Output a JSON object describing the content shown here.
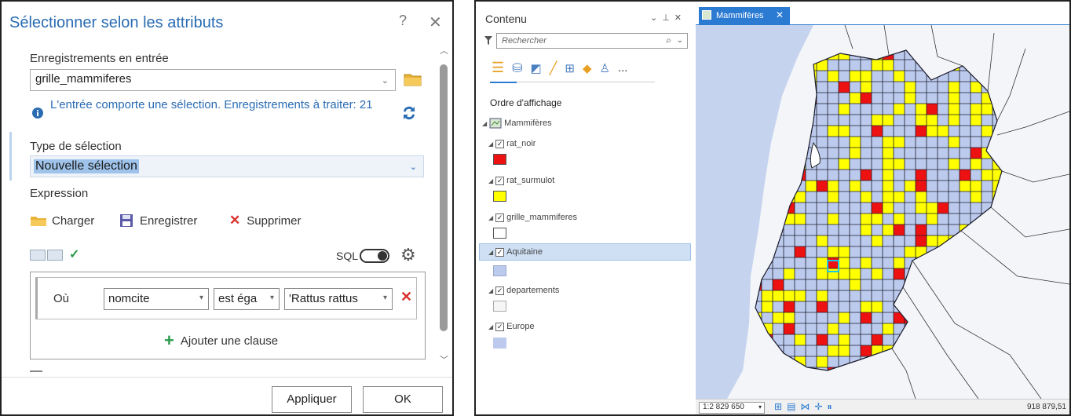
{
  "dialog": {
    "title": "Sélectionner selon les attributs",
    "help_label": "?",
    "close_label": "✕",
    "input_label": "Enregistrements en entrée",
    "input_value": "grille_mammiferes",
    "info_text": "L'entrée comporte une sélection. Enregistrements à traiter: 21",
    "selection_type_label": "Type de sélection",
    "selection_type_value": "Nouvelle sélection",
    "expression_label": "Expression",
    "toolbar": {
      "load": "Charger",
      "save": "Enregistrer",
      "delete": "Supprimer"
    },
    "sql_label": "SQL",
    "clause": {
      "where": "Où",
      "field": "nomcite",
      "operator": "est éga",
      "value": "'Rattus rattus"
    },
    "add_clause": "Ajouter une clause",
    "apply_button": "Appliquer",
    "ok_button": "OK"
  },
  "contents": {
    "title": "Contenu",
    "search_placeholder": "Rechercher",
    "draw_order": "Ordre d'affichage",
    "map_name": "Mammifères",
    "more": "...",
    "layers": [
      {
        "name": "rat_noir",
        "swatch": "#ee1111"
      },
      {
        "name": "rat_surmulot",
        "swatch": "#ffff00"
      },
      {
        "name": "grille_mammiferes",
        "swatch": "#ffffff"
      },
      {
        "name": "Aquitaine",
        "swatch": "#bccbed"
      },
      {
        "name": "departements",
        "swatch": "#f6f6f6"
      },
      {
        "name": "Europe",
        "swatch": "#bccbed"
      }
    ]
  },
  "map": {
    "tab_label": "Mammifères",
    "scale": "1:2 829 650",
    "coordinate": "918 879,51",
    "colors": {
      "sea": "#c5d3ee",
      "land": "#f3f5f9",
      "region": "#bccbed",
      "rat_noir": "#ee1111",
      "rat_surmulot": "#ffff00",
      "grid": "#1a1a2a",
      "accent": "#2b7bd3"
    }
  }
}
